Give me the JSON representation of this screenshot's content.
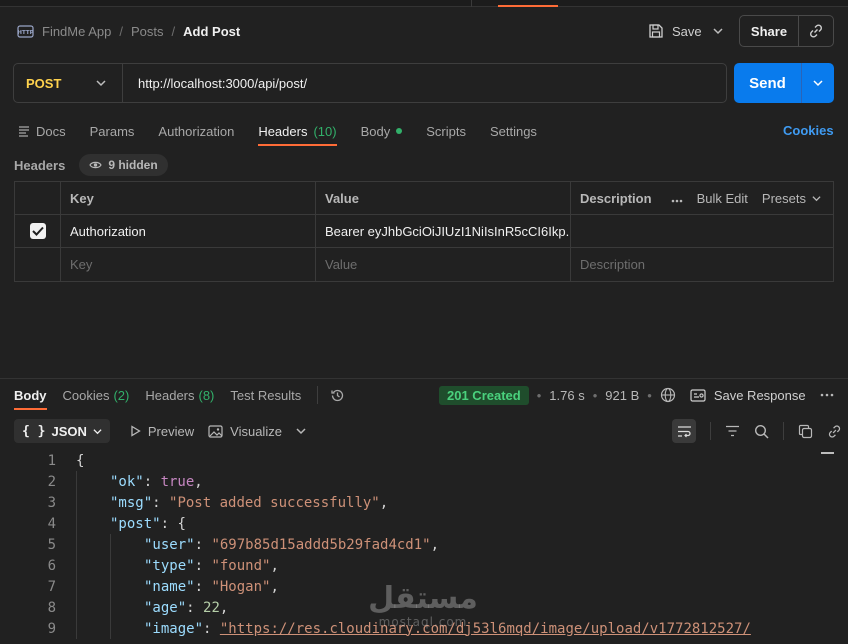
{
  "breadcrumb": {
    "collection": "FindMe App",
    "folder": "Posts",
    "current": "Add Post",
    "separator": "/"
  },
  "toolbar": {
    "save_label": "Save",
    "share_label": "Share"
  },
  "request": {
    "method": "POST",
    "url": "http://localhost:3000/api/post/",
    "send_label": "Send"
  },
  "tabs": {
    "docs": "Docs",
    "params": "Params",
    "authorization": "Authorization",
    "headers": "Headers",
    "headers_count": "(10)",
    "body": "Body",
    "scripts": "Scripts",
    "settings": "Settings",
    "cookies": "Cookies"
  },
  "headers_panel": {
    "title": "Headers",
    "hidden_label": "9 hidden",
    "columns": {
      "key": "Key",
      "value": "Value",
      "description": "Description"
    },
    "bulk_edit": "Bulk Edit",
    "presets": "Presets",
    "rows": [
      {
        "checked": true,
        "key": "Authorization",
        "value": "Bearer eyJhbGciOiJIUzI1NiIsInR5cCI6Ikp..."
      }
    ],
    "placeholders": {
      "key": "Key",
      "value": "Value",
      "description": "Description"
    }
  },
  "response": {
    "tabs": {
      "body": "Body",
      "cookies": "Cookies",
      "cookies_count": "(2)",
      "headers": "Headers",
      "headers_count": "(8)",
      "test_results": "Test Results"
    },
    "status": "201 Created",
    "time": "1.76 s",
    "size": "921 B",
    "save_response": "Save Response",
    "format": "JSON",
    "preview": "Preview",
    "visualize": "Visualize",
    "lines": [
      {
        "n": "1",
        "text": "{"
      },
      {
        "n": "2",
        "key": "\"ok\"",
        "val": "true",
        "vtype": "b",
        "tail": ","
      },
      {
        "n": "3",
        "key": "\"msg\"",
        "val": "\"Post added successfully\"",
        "vtype": "s",
        "tail": ","
      },
      {
        "n": "4",
        "key": "\"post\"",
        "val": "{",
        "vtype": "p",
        "tail": ""
      },
      {
        "n": "5",
        "key": "\"user\"",
        "val": "\"697b85d15addd5b29fad4cd1\"",
        "vtype": "s",
        "tail": ","
      },
      {
        "n": "6",
        "key": "\"type\"",
        "val": "\"found\"",
        "vtype": "s",
        "tail": ","
      },
      {
        "n": "7",
        "key": "\"name\"",
        "val": "\"Hogan\"",
        "vtype": "s",
        "tail": ","
      },
      {
        "n": "8",
        "key": "\"age\"",
        "val": "22",
        "vtype": "n",
        "tail": ","
      },
      {
        "n": "9",
        "key": "\"image\"",
        "val": "\"https://res.cloudinary.com/dj53l6mqd/image/upload/v1772812527/",
        "vtype": "u",
        "tail": ""
      }
    ]
  },
  "watermark": {
    "main": "مستقل",
    "sub": "mostaql.com"
  }
}
